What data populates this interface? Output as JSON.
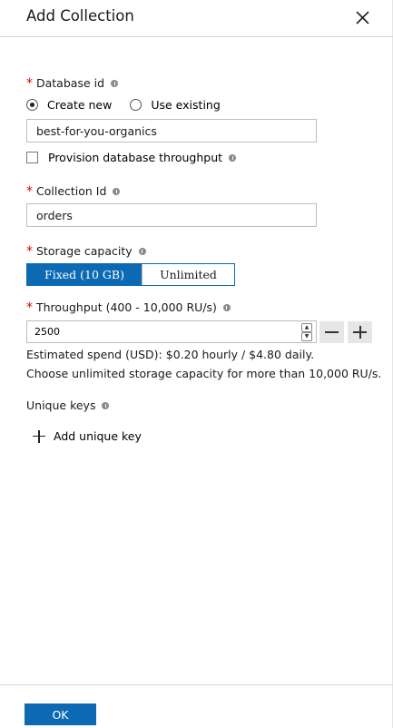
{
  "header": {
    "title": "Add Collection"
  },
  "database": {
    "label": "Database id",
    "options": [
      "Create new",
      "Use existing"
    ],
    "value": "best-for-you-organics",
    "provision_label": "Provision database throughput"
  },
  "collection": {
    "label": "Collection Id",
    "value": "orders"
  },
  "storage": {
    "label": "Storage capacity",
    "options": [
      "Fixed (10 GB)",
      "Unlimited"
    ],
    "selected": "Fixed (10 GB)"
  },
  "throughput": {
    "label": "Throughput (400 - 10,000 RU/s)",
    "value": "2500",
    "estimate": "Estimated spend (USD): $0.20 hourly / $4.80 daily.",
    "note": "Choose unlimited storage capacity for more than 10,000 RU/s."
  },
  "unique_keys": {
    "label": "Unique keys",
    "add_label": "Add unique key"
  },
  "footer": {
    "ok_label": "OK"
  },
  "colors": {
    "accent": "#0c6ab4",
    "required": "#e00000"
  }
}
